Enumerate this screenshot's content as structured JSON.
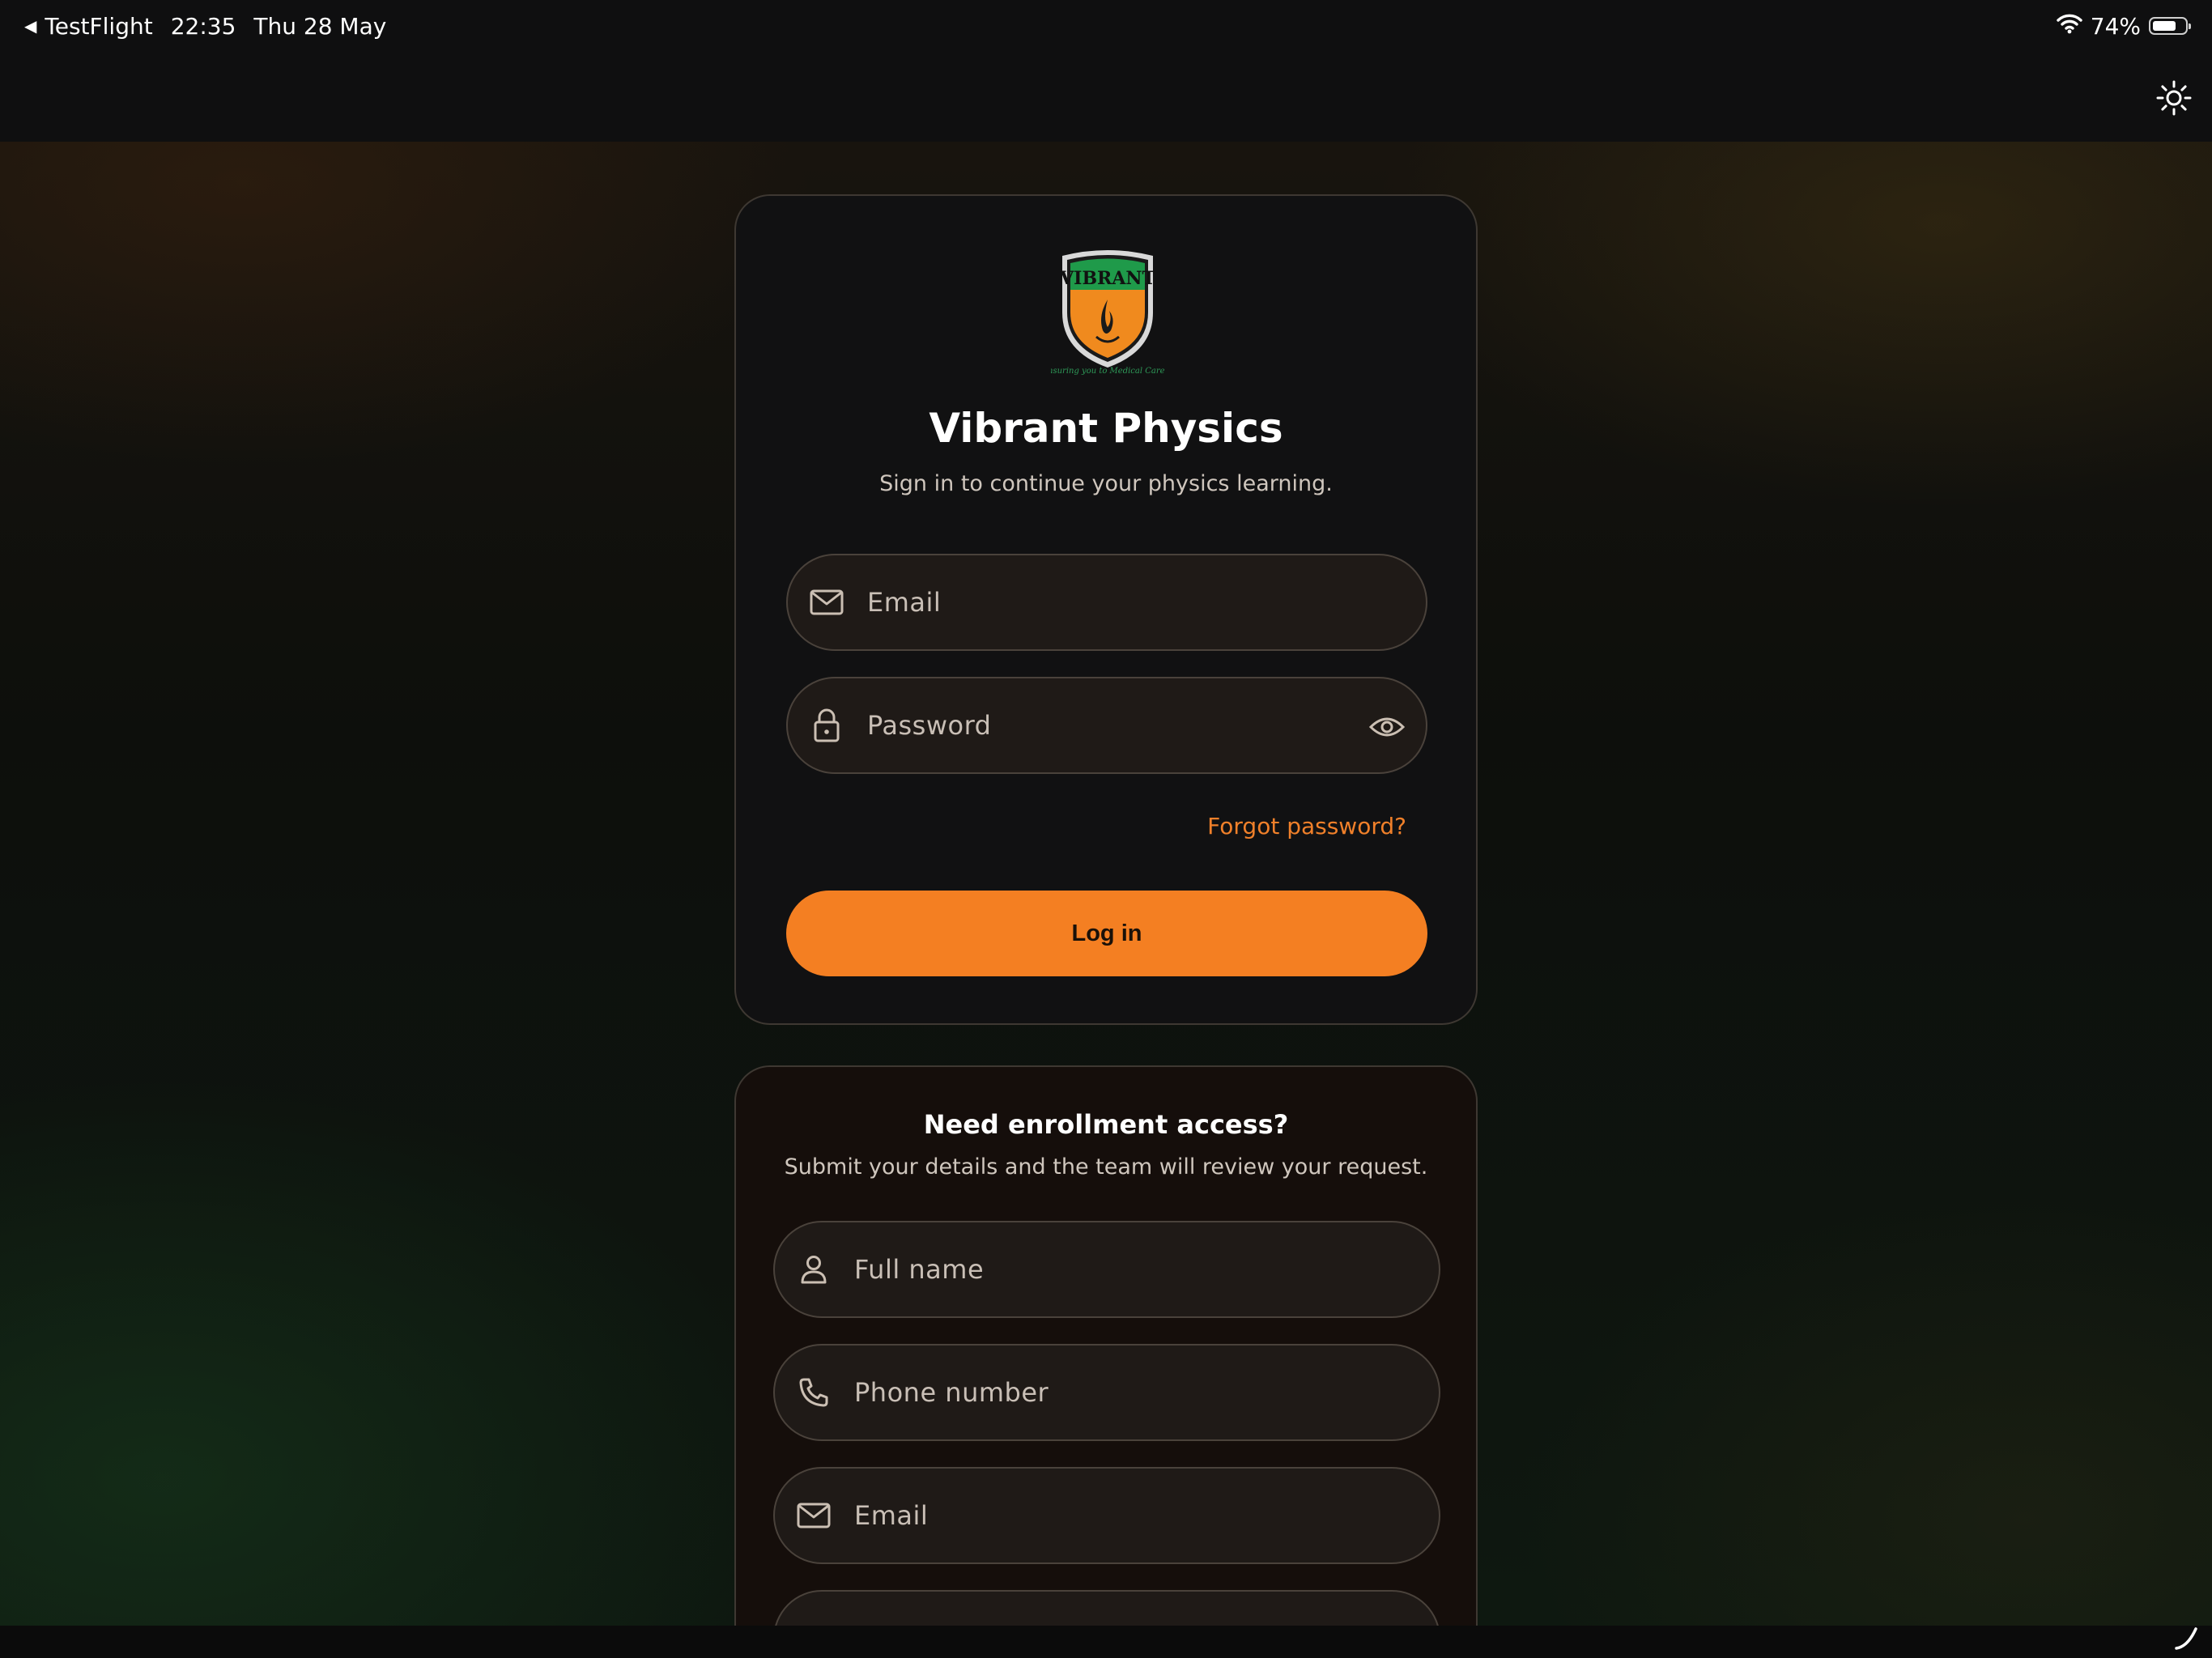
{
  "status_bar": {
    "back_app": "TestFlight",
    "time": "22:35",
    "date": "Thu 28 May",
    "battery_percent": "74%",
    "battery_level": 0.74
  },
  "icons": {
    "back": "back-arrow-icon",
    "wifi": "wifi-icon",
    "battery": "battery-icon",
    "theme": "sun-icon",
    "email": "envelope-icon",
    "password": "lock-icon",
    "visibility": "eye-icon",
    "name": "person-icon",
    "phone": "phone-icon"
  },
  "brand": {
    "logo_text": "VIBRANT",
    "logo_tagline": "Ensuring you to Medical Career",
    "logo_colors": {
      "green": "#1f9a4a",
      "orange": "#f08a1e",
      "rim": "#d9d9d9"
    }
  },
  "login": {
    "title": "Vibrant Physics",
    "subtitle": "Sign in to continue your physics learning.",
    "email_placeholder": "Email",
    "password_placeholder": "Password",
    "forgot_label": "Forgot password?",
    "login_label": "Log in"
  },
  "enrollment": {
    "title": "Need enrollment access?",
    "subtitle": "Submit your details and the team will review your request.",
    "name_placeholder": "Full name",
    "phone_placeholder": "Phone number",
    "email_placeholder": "Email"
  },
  "colors": {
    "accent": "#f47f22",
    "link": "#f0802a",
    "field_bg": "#1f1a17",
    "card_border": "#3e3832"
  }
}
